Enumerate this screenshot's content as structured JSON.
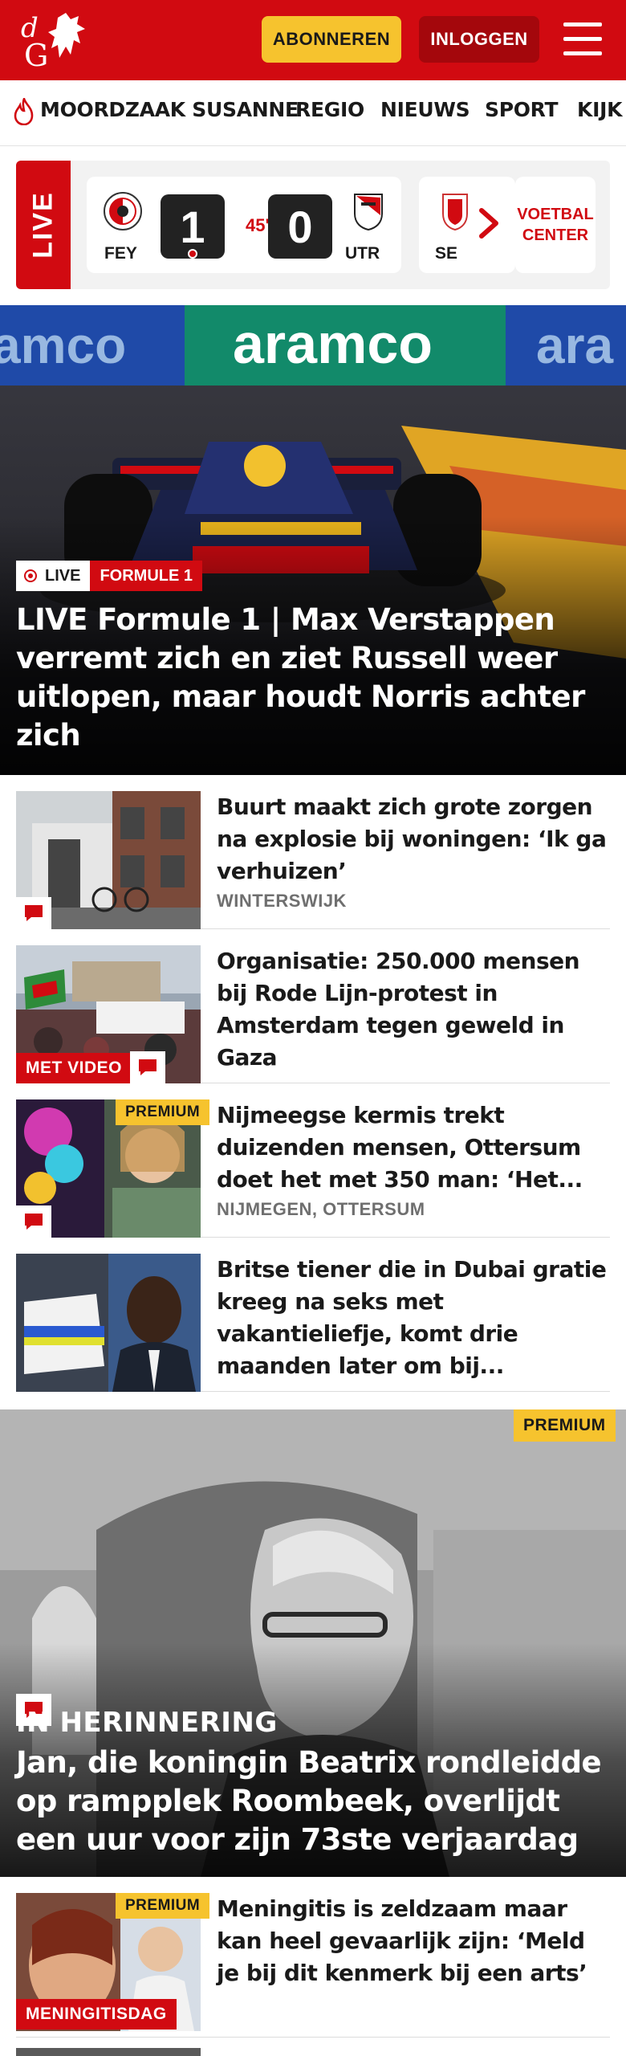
{
  "header": {
    "logo_text": "dG",
    "subscribe_label": "ABONNEREN",
    "login_label": "INLOGGEN"
  },
  "nav": {
    "items": [
      "MOORDZAAK SUSANNE",
      "REGIO",
      "NIEUWS",
      "SPORT",
      "KIJK"
    ]
  },
  "live_scores": {
    "live_label": "LIVE",
    "match": {
      "home": "FEY",
      "away": "UTR",
      "home_score": "1",
      "away_score": "0",
      "minute": "45'"
    },
    "next_match_team": "SE",
    "voetbal_center_line1": "VOETBAL",
    "voetbal_center_line2": "CENTER"
  },
  "hero": {
    "live_tag": "LIVE",
    "category": "FORMULE 1",
    "title": "LIVE Formule 1 | Max Verstappen verremt zich en ziet Russell weer uitlopen, maar houdt Norris achter zich",
    "banner_text": "aramco"
  },
  "articles": [
    {
      "title": "Buurt maakt zich grote zorgen na explosie bij woningen: ‘Ik ga verhuizen’",
      "location": "WINTERSWIJK"
    },
    {
      "title": "Organisatie: 250.000 mensen bij Rode Lijn-protest in Amsterdam tegen geweld in Gaza",
      "badge": "MET VIDEO"
    },
    {
      "title": "Nijmeegse kermis trekt duizenden mensen, Ottersum doet het met 350 man: ‘Het...",
      "location": "NIJMEGEN, OTTERSUM",
      "premium": "PREMIUM"
    },
    {
      "title": "Britse tiener die in Dubai gratie kreeg na seks met vakantieliefje, komt drie maanden later om bij..."
    }
  ],
  "feature": {
    "premium": "PREMIUM",
    "kicker": "IN HERINNERING",
    "title": "Jan, die koningin Beatrix rondleidde op rampplek Roombeek, overlijdt een uur voor zijn 73ste verjaardag"
  },
  "bottom_article": {
    "title": "Meningitis is zeldzaam maar kan heel gevaarlijk zijn: ‘Meld je bij dit kenmerk bij een arts’",
    "premium": "PREMIUM",
    "badge": "MENINGITISDAG"
  },
  "colors": {
    "brand_red": "#d10a11",
    "subscribe_yellow": "#f6c32e",
    "login_dark_red": "#a4070c"
  }
}
